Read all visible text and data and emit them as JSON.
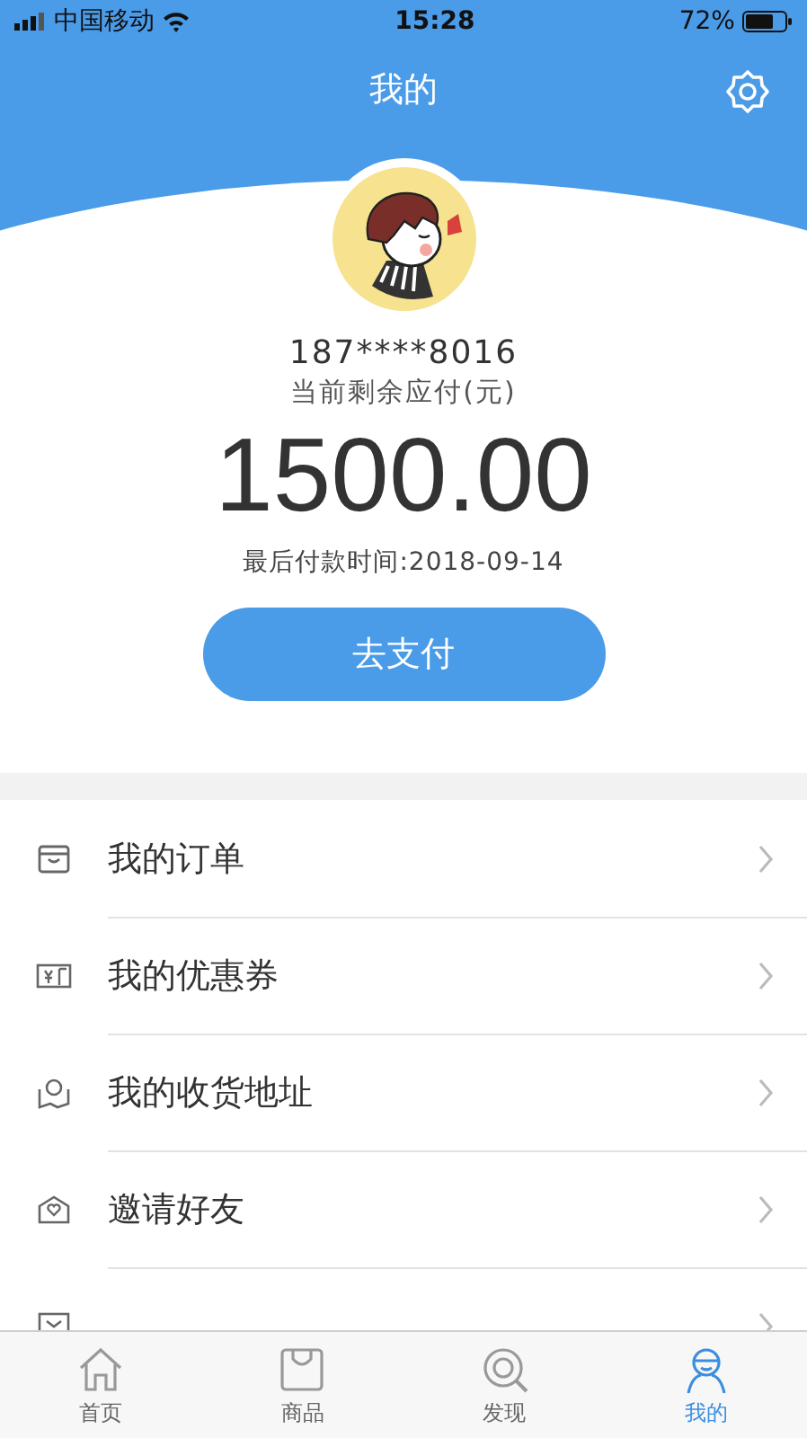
{
  "status_bar": {
    "carrier": "中国移动",
    "time": "15:28",
    "battery": "72%"
  },
  "header": {
    "title": "我的"
  },
  "profile": {
    "phone": "187****8016",
    "balance_label": "当前剩余应付(元)",
    "balance": "1500.00",
    "due_date": "最后付款时间:2018-09-14",
    "pay_button": "去支付"
  },
  "menu": [
    {
      "kind": "order",
      "label": "我的订单"
    },
    {
      "kind": "coupon",
      "label": "我的优惠券"
    },
    {
      "kind": "address",
      "label": "我的收货地址"
    },
    {
      "kind": "invite",
      "label": "邀请好友"
    },
    {
      "kind": "verify"
    }
  ],
  "tab_bar": [
    {
      "kind": "home",
      "label": "首页",
      "selected": false
    },
    {
      "kind": "goods",
      "label": "商品",
      "selected": false
    },
    {
      "kind": "discover",
      "label": "发现",
      "selected": false
    },
    {
      "kind": "me",
      "label": "我的",
      "selected": true
    }
  ]
}
